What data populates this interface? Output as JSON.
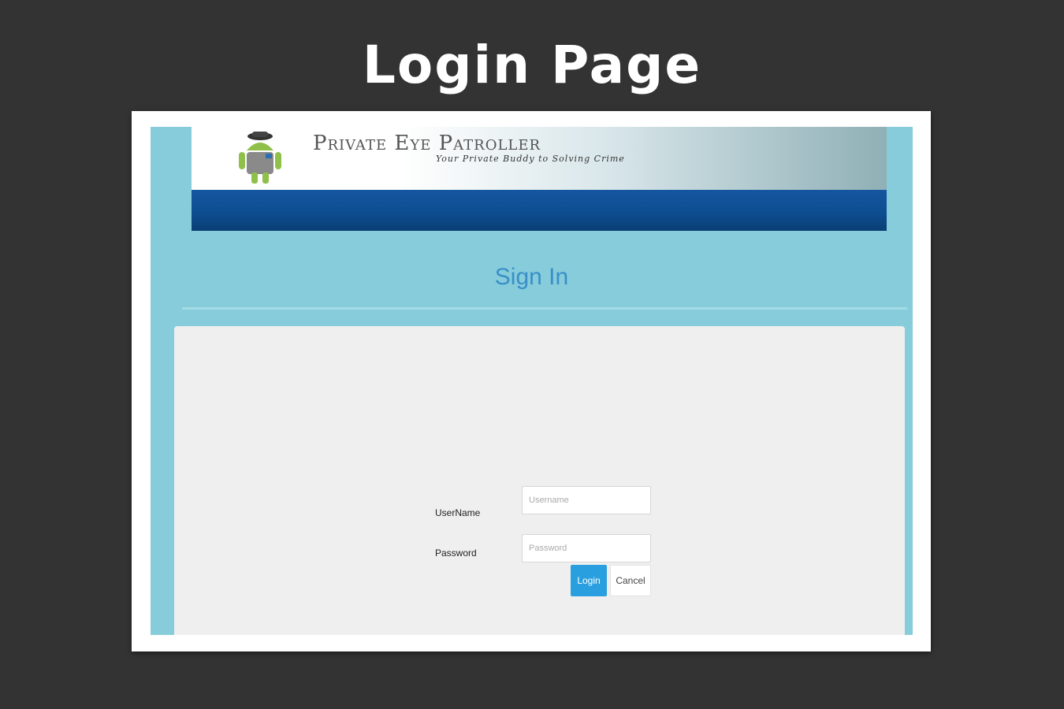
{
  "slide": {
    "title": "Login Page"
  },
  "app": {
    "brand": {
      "title": "Private Eye Patroller",
      "tagline": "Your Private Buddy to Solving Crime"
    },
    "logo_icon": "android-detective-icon",
    "nav": {
      "background_color": "#0d4c8f"
    },
    "page_background_color": "#86ccdb",
    "signin": {
      "heading": "Sign In",
      "username": {
        "label": "UserName",
        "placeholder": "Username",
        "value": ""
      },
      "password": {
        "label": "Password",
        "placeholder": "Password",
        "value": ""
      },
      "login_label": "Login",
      "cancel_label": "Cancel",
      "login_color": "#2a9fe0"
    }
  }
}
